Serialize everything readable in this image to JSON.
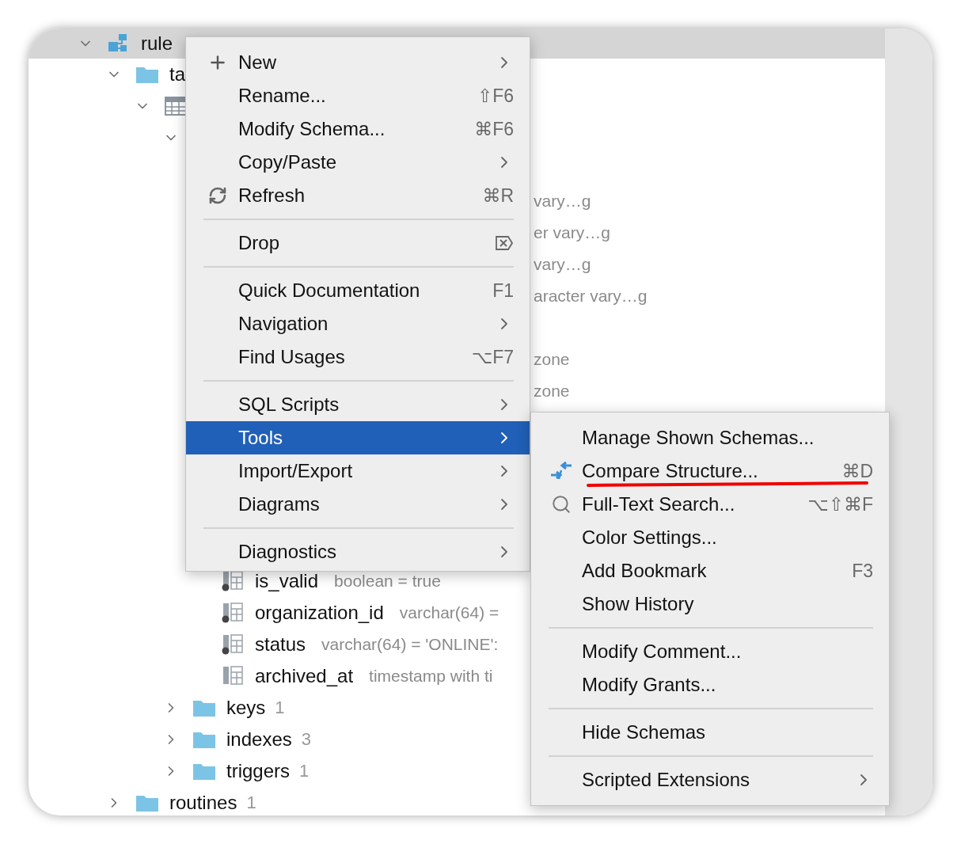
{
  "tree": [
    {
      "kind": "schema",
      "label": "rule",
      "expanded": true,
      "selected": true,
      "children": [
        {
          "kind": "folder",
          "label": "ta",
          "expanded": true,
          "children": [
            {
              "kind": "table",
              "expanded": true,
              "children": [
                {
                  "kind": "folder",
                  "expanded": true,
                  "children": [
                    {
                      "kind": "column"
                    },
                    {
                      "kind": "column",
                      "type": "vary…g"
                    },
                    {
                      "kind": "column",
                      "type": "er vary…g"
                    },
                    {
                      "kind": "column",
                      "type": "vary…g"
                    },
                    {
                      "kind": "column",
                      "type": "aracter vary…g"
                    },
                    {
                      "kind": "column"
                    },
                    {
                      "kind": "column",
                      "type": "zone"
                    },
                    {
                      "kind": "column",
                      "type": "zone"
                    },
                    {
                      "kind": "column"
                    },
                    {
                      "kind": "column"
                    },
                    {
                      "kind": "column"
                    },
                    {
                      "kind": "column"
                    },
                    {
                      "kind": "column"
                    },
                    {
                      "kind": "column",
                      "label": "is_valid",
                      "type": "boolean = true",
                      "required": true
                    },
                    {
                      "kind": "column",
                      "label": "organization_id",
                      "type": "varchar(64) =",
                      "required": true
                    },
                    {
                      "kind": "column",
                      "label": "status",
                      "type": "varchar(64) = 'ONLINE':",
                      "required": true
                    },
                    {
                      "kind": "column",
                      "label": "archived_at",
                      "type": "timestamp with ti",
                      "required": false
                    }
                  ]
                },
                {
                  "kind": "folder",
                  "label": "keys",
                  "count": "1",
                  "expanded": false
                },
                {
                  "kind": "folder",
                  "label": "indexes",
                  "count": "3",
                  "expanded": false
                },
                {
                  "kind": "folder",
                  "label": "triggers",
                  "count": "1",
                  "expanded": false
                }
              ]
            }
          ]
        },
        {
          "kind": "folder",
          "label": "routines",
          "count": "1",
          "expanded": false
        }
      ]
    }
  ],
  "context_menu": [
    {
      "kind": "item",
      "label": "New",
      "submenu": true,
      "selected": false
    },
    {
      "kind": "item",
      "label": "Rename...",
      "shortcut": "⇧F6",
      "submenu": false,
      "selected": false
    },
    {
      "kind": "item",
      "label": "Modify Schema...",
      "shortcut": "⌘F6",
      "submenu": false,
      "selected": false
    },
    {
      "kind": "item",
      "label": "Copy/Paste",
      "submenu": true,
      "selected": false
    },
    {
      "kind": "item",
      "label": "Refresh",
      "shortcut": "⌘R",
      "submenu": false,
      "selected": false
    },
    {
      "kind": "separator"
    },
    {
      "kind": "item",
      "label": "Drop",
      "submenu": false,
      "selected": false
    },
    {
      "kind": "separator"
    },
    {
      "kind": "item",
      "label": "Quick Documentation",
      "shortcut": "F1",
      "submenu": false,
      "selected": false
    },
    {
      "kind": "item",
      "label": "Navigation",
      "submenu": true,
      "selected": false
    },
    {
      "kind": "item",
      "label": "Find Usages",
      "shortcut": "⌥F7",
      "submenu": false,
      "selected": false
    },
    {
      "kind": "separator"
    },
    {
      "kind": "item",
      "label": "SQL Scripts",
      "submenu": true,
      "selected": false
    },
    {
      "kind": "item",
      "label": "Tools",
      "submenu": true,
      "selected": true
    },
    {
      "kind": "item",
      "label": "Import/Export",
      "submenu": true,
      "selected": false
    },
    {
      "kind": "item",
      "label": "Diagrams",
      "submenu": true,
      "selected": false
    },
    {
      "kind": "separator"
    },
    {
      "kind": "item",
      "label": "Diagnostics",
      "submenu": true,
      "selected": false
    }
  ],
  "tools_submenu": [
    {
      "kind": "item",
      "label": "Manage Shown Schemas...",
      "submenu": false,
      "selected": false
    },
    {
      "kind": "item",
      "label": "Compare Structure...",
      "shortcut": "⌘D",
      "submenu": false,
      "selected": false,
      "underlined": true
    },
    {
      "kind": "item",
      "label": "Full-Text Search...",
      "shortcut": "⌥⇧⌘F",
      "submenu": false,
      "selected": false
    },
    {
      "kind": "item",
      "label": "Color Settings...",
      "submenu": false,
      "selected": false
    },
    {
      "kind": "item",
      "label": "Add Bookmark",
      "shortcut": "F3",
      "submenu": false,
      "selected": false
    },
    {
      "kind": "item",
      "label": "Show History",
      "submenu": false,
      "selected": false
    },
    {
      "kind": "separator"
    },
    {
      "kind": "item",
      "label": "Modify Comment...",
      "submenu": false,
      "selected": false
    },
    {
      "kind": "item",
      "label": "Modify Grants...",
      "submenu": false,
      "selected": false
    },
    {
      "kind": "separator"
    },
    {
      "kind": "item",
      "label": "Hide Schemas",
      "submenu": false,
      "selected": false
    },
    {
      "kind": "separator"
    },
    {
      "kind": "item",
      "label": "Scripted Extensions",
      "submenu": true,
      "selected": false
    }
  ]
}
